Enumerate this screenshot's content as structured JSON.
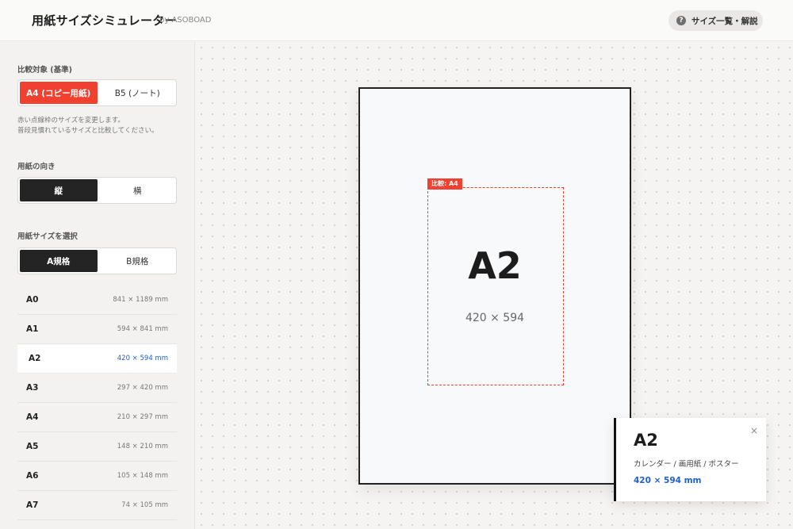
{
  "header": {
    "title": "用紙サイズシミュレーター",
    "by": "by ASOBOAD",
    "help_label": "サイズ一覧・解説",
    "help_icon": "question-circle-icon"
  },
  "sidebar": {
    "compare_label": "比較対象 (基準)",
    "compare_options": [
      "A4 (コピー用紙)",
      "B5 (ノート)"
    ],
    "note_line1": "赤い点線枠のサイズを変更します。",
    "note_line2": "普段見慣れているサイズと比較してください。",
    "orientation_label": "用紙の向き",
    "orientation_options": [
      "縦",
      "横"
    ],
    "size_label": "用紙サイズを選択",
    "series_options": [
      "A規格",
      "B規格"
    ],
    "sizes": [
      {
        "name": "A0",
        "dims": "841 × 1189 mm"
      },
      {
        "name": "A1",
        "dims": "594 × 841 mm"
      },
      {
        "name": "A2",
        "dims": "420 × 594 mm"
      },
      {
        "name": "A3",
        "dims": "297 × 420 mm"
      },
      {
        "name": "A4",
        "dims": "210 × 297 mm"
      },
      {
        "name": "A5",
        "dims": "148 × 210 mm"
      },
      {
        "name": "A6",
        "dims": "105 × 148 mm"
      },
      {
        "name": "A7",
        "dims": "74 × 105 mm"
      }
    ]
  },
  "canvas": {
    "compare_tag": "比較: A4",
    "paper_name": "A2",
    "paper_dims": "420 × 594"
  },
  "info": {
    "name": "A2",
    "use": "カレンダー / 画用紙 / ポスター",
    "dims": "420 × 594 mm",
    "close": "×"
  },
  "colors": {
    "accent_red": "#f0402f",
    "active_dark": "#242424",
    "link_blue": "#1f5fd6"
  }
}
